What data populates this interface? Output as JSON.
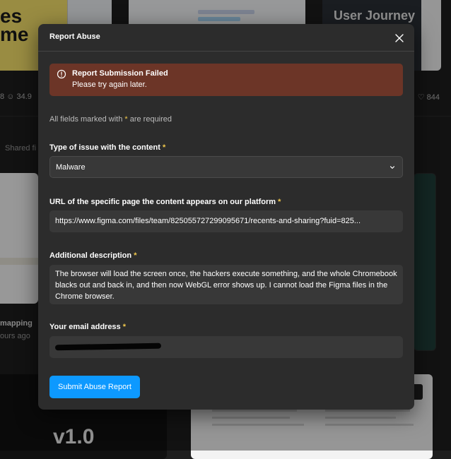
{
  "background": {
    "card_text_1_lines": [
      "es",
      "me"
    ],
    "card_text_3": "User Journey",
    "stats_left": "8  ☺ 34.9",
    "stats_right": "♡ 844",
    "shared_label": "Shared fi",
    "card_mapping": "mapping",
    "card_hours": "ours ago",
    "card_version": "v1.0"
  },
  "modal": {
    "title": "Report Abuse",
    "close_icon": "close-icon",
    "alert": {
      "icon": "alert-circle-icon",
      "title": "Report Submission Failed",
      "message": "Please try again later.",
      "color": "#6c3527"
    },
    "required_note_prefix": "All fields marked with ",
    "required_star": "*",
    "required_note_suffix": " are required",
    "fields": {
      "issue_type": {
        "label": "Type of issue with the content",
        "value": "Malware"
      },
      "url": {
        "label": "URL of the specific page the content appears on our platform",
        "value": "https://www.figma.com/files/team/825055727299095671/recents-and-sharing?fuid=825..."
      },
      "description": {
        "label": "Additional description",
        "value": "The browser will load the screen once, the hackers execute something, and the whole Chromebook blacks out and back in, and then now WebGL error shows up. I cannot load the Figma files in the Chrome browser."
      },
      "email": {
        "label": "Your email address",
        "value": ""
      }
    },
    "submit_label": "Submit Abuse Report",
    "accent_color": "#0d99ff"
  }
}
